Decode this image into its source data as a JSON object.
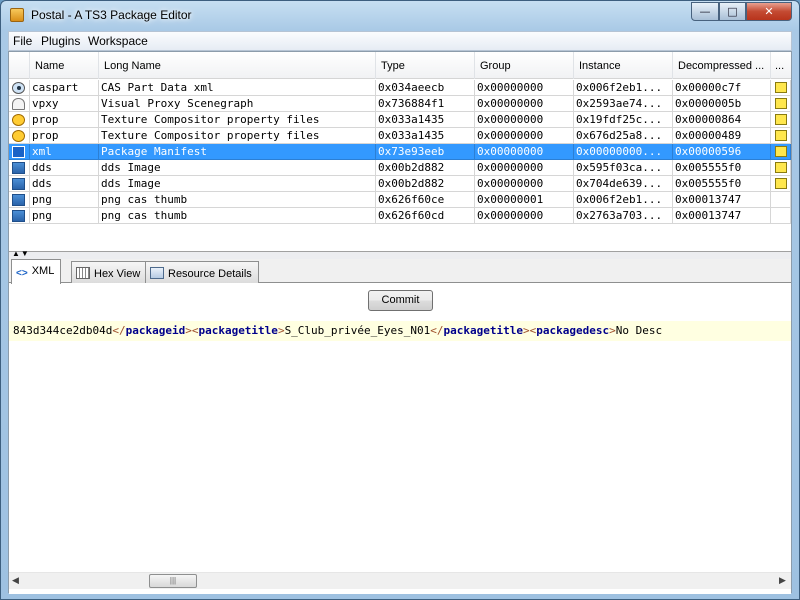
{
  "window": {
    "title": "Postal - A TS3 Package Editor",
    "min_glyph": "—",
    "max_glyph": "□",
    "close_glyph": "✕"
  },
  "menu": [
    "File",
    "Plugins",
    "Workspace"
  ],
  "table": {
    "columns": [
      "Name",
      "Long Name",
      "Type",
      "Group",
      "Instance",
      "Decompressed ...",
      "..."
    ],
    "rows": [
      {
        "icon": "eye-icon",
        "name": "caspart",
        "long": "CAS Part Data xml",
        "type": "0x034aeecb",
        "group": "0x00000000",
        "instance": "0x006f2eb1...",
        "decompressed": "0x00000c7f",
        "flag": true,
        "selected": false
      },
      {
        "icon": "proxy-icon",
        "name": "vpxy",
        "long": "Visual Proxy Scenegraph",
        "type": "0x736884f1",
        "group": "0x00000000",
        "instance": "0x2593ae74...",
        "decompressed": "0x0000005b",
        "flag": true,
        "selected": false
      },
      {
        "icon": "smiley-icon",
        "name": "prop",
        "long": "Texture Compositor property files",
        "type": "0x033a1435",
        "group": "0x00000000",
        "instance": "0x19fdf25c...",
        "decompressed": "0x00000864",
        "flag": true,
        "selected": false
      },
      {
        "icon": "smiley-icon",
        "name": "prop",
        "long": "Texture Compositor property files",
        "type": "0x033a1435",
        "group": "0x00000000",
        "instance": "0x676d25a8...",
        "decompressed": "0x00000489",
        "flag": true,
        "selected": false
      },
      {
        "icon": "xml-icon",
        "name": "xml",
        "long": "Package Manifest",
        "type": "0x73e93eeb",
        "group": "0x00000000",
        "instance": "0x00000000...",
        "decompressed": "0x00000596",
        "flag": true,
        "selected": true
      },
      {
        "icon": "image-icon",
        "name": "dds",
        "long": "dds Image",
        "type": "0x00b2d882",
        "group": "0x00000000",
        "instance": "0x595f03ca...",
        "decompressed": "0x005555f0",
        "flag": true,
        "selected": false
      },
      {
        "icon": "image-icon",
        "name": "dds",
        "long": "dds Image",
        "type": "0x00b2d882",
        "group": "0x00000000",
        "instance": "0x704de639...",
        "decompressed": "0x005555f0",
        "flag": true,
        "selected": false
      },
      {
        "icon": "image-icon",
        "name": "png",
        "long": "png cas thumb",
        "type": "0x626f60ce",
        "group": "0x00000001",
        "instance": "0x006f2eb1...",
        "decompressed": "0x00013747",
        "flag": false,
        "selected": false
      },
      {
        "icon": "image-icon",
        "name": "png",
        "long": "png cas thumb",
        "type": "0x626f60cd",
        "group": "0x00000000",
        "instance": "0x2763a703...",
        "decompressed": "0x00013747",
        "flag": false,
        "selected": false
      }
    ]
  },
  "tabs": [
    {
      "label": "XML",
      "icon": "xml-tab-icon",
      "glyph": "<>",
      "active": true
    },
    {
      "label": "Hex View",
      "icon": "hex-grid-icon",
      "glyph": "",
      "active": false
    },
    {
      "label": "Resource Details",
      "icon": "resource-details-icon",
      "glyph": "",
      "active": false
    }
  ],
  "xml_panel": {
    "commit_label": "Commit",
    "line": [
      {
        "t": "text",
        "v": "843d344ce2db04d"
      },
      {
        "t": "br",
        "v": "</"
      },
      {
        "t": "tag",
        "v": "packageid"
      },
      {
        "t": "br",
        "v": ">"
      },
      {
        "t": "br",
        "v": "<"
      },
      {
        "t": "tag",
        "v": "packagetitle"
      },
      {
        "t": "br",
        "v": ">"
      },
      {
        "t": "text",
        "v": "S_Club_privée_Eyes_N01"
      },
      {
        "t": "br",
        "v": "</"
      },
      {
        "t": "tag",
        "v": "packagetitle"
      },
      {
        "t": "br",
        "v": ">"
      },
      {
        "t": "br",
        "v": "<"
      },
      {
        "t": "tag",
        "v": "packagedesc"
      },
      {
        "t": "br",
        "v": ">"
      },
      {
        "t": "text",
        "v": "No Desc"
      }
    ]
  },
  "splitter_glyph": "▲▼",
  "scrollbar": {
    "left_arrow": "◀",
    "right_arrow": "▶",
    "thumb_grip": "|||"
  },
  "colors": {
    "selection": "#3399ff",
    "xml_line_bg": "#ffffe1",
    "xml_tag": "#00008b",
    "xml_bracket": "#a0522d"
  }
}
